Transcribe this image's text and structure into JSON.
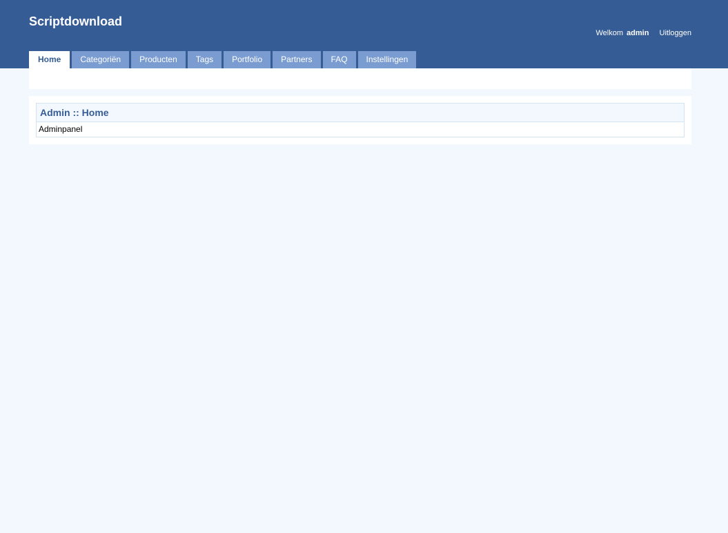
{
  "header": {
    "site_title": "Scriptdownload",
    "user": {
      "welcome_text": "Welkom",
      "username": "admin",
      "logout_label": "Uitloggen"
    }
  },
  "nav": {
    "tabs": [
      {
        "label": "Home",
        "active": true
      },
      {
        "label": "Categoriën",
        "active": false
      },
      {
        "label": "Producten",
        "active": false
      },
      {
        "label": "Tags",
        "active": false
      },
      {
        "label": "Portfolio",
        "active": false
      },
      {
        "label": "Partners",
        "active": false
      },
      {
        "label": "FAQ",
        "active": false
      },
      {
        "label": "Instellingen",
        "active": false
      }
    ]
  },
  "main": {
    "box_title": "Admin :: Home",
    "box_body": "Adminpanel"
  },
  "colors": {
    "header_bg": "#365c95",
    "tab_bg": "#7a9cd0",
    "page_bg": "#f2f8fe",
    "border": "#d4e3f2"
  }
}
